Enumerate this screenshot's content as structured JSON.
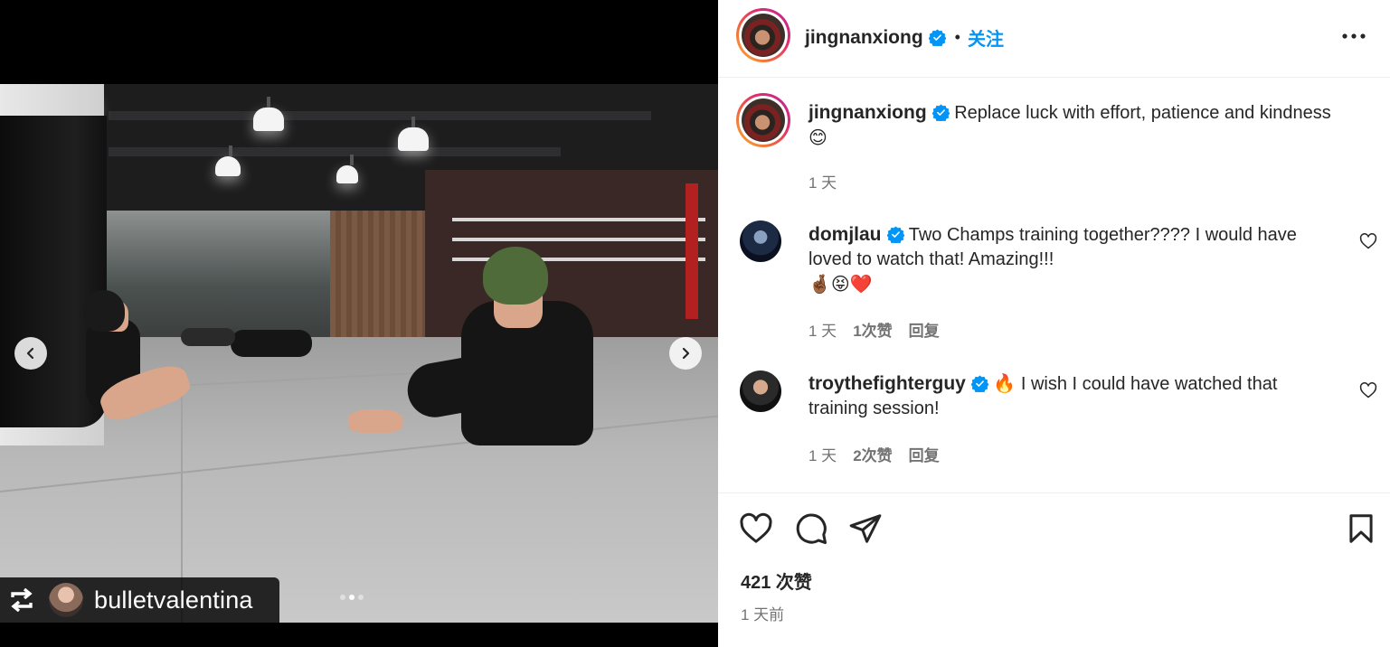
{
  "media": {
    "repost_username": "bulletvalentina",
    "carousel_index": 2,
    "carousel_total": 3
  },
  "post": {
    "author": "jingnanxiong",
    "follow_label": "关注",
    "separator": "•",
    "caption": "Replace luck with effort, patience and kindness",
    "caption_emoji": "😊",
    "caption_time": "1 天"
  },
  "comments": [
    {
      "username": "domjlau",
      "text": "Two Champs training together???? I would have loved to watch that! Amazing!!!",
      "emojis": "🤞🏾😝❤️",
      "time": "1 天",
      "likes": "1次赞",
      "reply": "回复"
    },
    {
      "username": "troythefighterguy",
      "prefix_emoji": "🔥",
      "text": "I wish I could have watched that training session!",
      "time": "1 天",
      "likes": "2次赞",
      "reply": "回复"
    }
  ],
  "footer": {
    "like_count": "421 次赞",
    "posted_ago": "1 天前"
  },
  "colors": {
    "accent": "#0095f6",
    "verified": "#0095f6",
    "muted_text": "#737373",
    "text": "#262626"
  }
}
